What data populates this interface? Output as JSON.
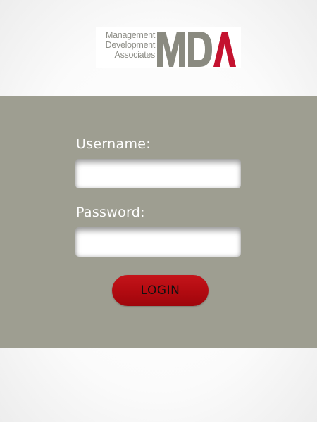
{
  "logo": {
    "text_lines": [
      "Management",
      "Development",
      "Associates"
    ],
    "mark_gray": "MD",
    "mark_red": "Λ",
    "gray_color": "#8a8a80",
    "red_color": "#c4122f"
  },
  "login": {
    "username_label": "Username:",
    "password_label": "Password:",
    "username_value": "",
    "password_value": "",
    "button_label": "LOGIN"
  },
  "colors": {
    "panel": "#9e9e91",
    "button": "#b30b11",
    "label_text": "#ffffff"
  }
}
